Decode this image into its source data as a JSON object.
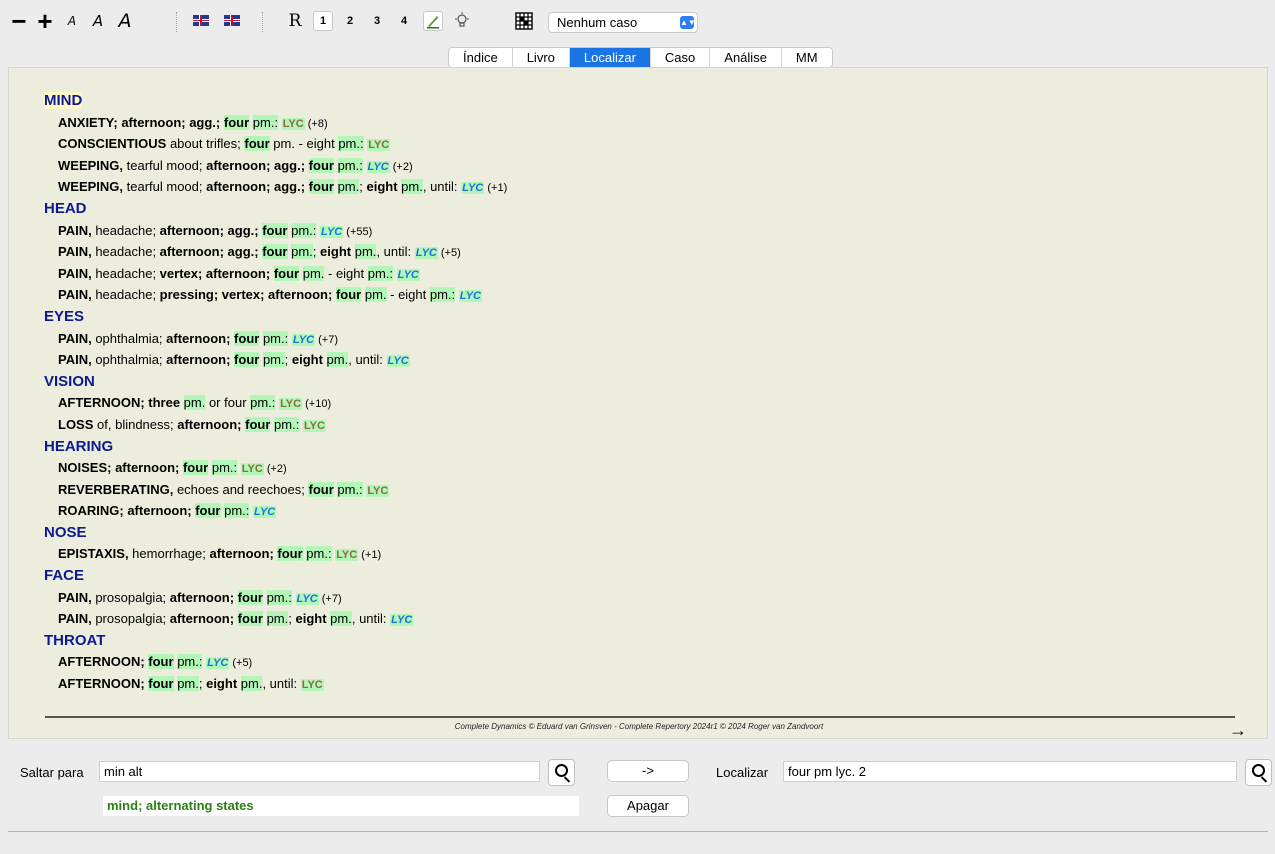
{
  "toolbar": {
    "zoom_out": "−",
    "zoom_in": "+",
    "font_small": "A",
    "font_medium": "A",
    "font_large": "A",
    "btn_r": "R",
    "btn_1": "1",
    "btn_2": "2",
    "btn_3": "3",
    "btn_4": "4",
    "case_select": "Nenhum caso"
  },
  "tabs": [
    "Índice",
    "Livro",
    "Localizar",
    "Caso",
    "Análise",
    "MM"
  ],
  "active_tab": "Localizar",
  "results": [
    {
      "kind": "chapter",
      "text": "MIND"
    },
    {
      "kind": "rubric",
      "parts": [
        [
          "ANXIETY; afternoon; agg.; ",
          "b"
        ],
        [
          "four",
          "bh"
        ],
        [
          " ",
          ""
        ],
        [
          "pm.:",
          "h"
        ],
        [
          " ",
          ""
        ],
        [
          "LYC",
          "g1"
        ],
        [
          " (+8)",
          "c"
        ]
      ]
    },
    {
      "kind": "rubric",
      "parts": [
        [
          "CONSCIENTIOUS",
          "b"
        ],
        [
          " about trifles; ",
          ""
        ],
        [
          "four",
          "bh"
        ],
        [
          " pm. - eight ",
          ""
        ],
        [
          "pm.:",
          "h"
        ],
        [
          " ",
          ""
        ],
        [
          "LYC",
          "g1"
        ]
      ]
    },
    {
      "kind": "rubric",
      "parts": [
        [
          "WEEPING,",
          "b"
        ],
        [
          " tearful mood; ",
          ""
        ],
        [
          "afternoon; agg.; ",
          "b"
        ],
        [
          "four",
          "bh"
        ],
        [
          " ",
          ""
        ],
        [
          "pm.:",
          "h"
        ],
        [
          " ",
          ""
        ],
        [
          "LYC",
          "g3"
        ],
        [
          " (+2)",
          "c"
        ]
      ]
    },
    {
      "kind": "rubric",
      "parts": [
        [
          "WEEPING,",
          "b"
        ],
        [
          " tearful mood; ",
          ""
        ],
        [
          "afternoon; agg.; ",
          "b"
        ],
        [
          "four",
          "bh"
        ],
        [
          " ",
          ""
        ],
        [
          "pm.",
          "h"
        ],
        [
          "; ",
          ""
        ],
        [
          "eight",
          "b"
        ],
        [
          " ",
          ""
        ],
        [
          "pm.",
          "h"
        ],
        [
          ", until: ",
          ""
        ],
        [
          "LYC",
          "g3"
        ],
        [
          " (+1)",
          "c"
        ]
      ]
    },
    {
      "kind": "chapter",
      "text": "HEAD"
    },
    {
      "kind": "rubric",
      "parts": [
        [
          "PAIN,",
          "b"
        ],
        [
          " headache; ",
          ""
        ],
        [
          "afternoon; agg.; ",
          "b"
        ],
        [
          "four",
          "bh"
        ],
        [
          " ",
          ""
        ],
        [
          "pm.:",
          "h"
        ],
        [
          " ",
          ""
        ],
        [
          "LYC",
          "g3"
        ],
        [
          " (+55)",
          "c"
        ]
      ]
    },
    {
      "kind": "rubric",
      "parts": [
        [
          "PAIN,",
          "b"
        ],
        [
          " headache; ",
          ""
        ],
        [
          "afternoon; agg.; ",
          "b"
        ],
        [
          "four",
          "bh"
        ],
        [
          " ",
          ""
        ],
        [
          "pm.",
          "h"
        ],
        [
          "; ",
          ""
        ],
        [
          "eight",
          "b"
        ],
        [
          " ",
          ""
        ],
        [
          "pm.",
          "h"
        ],
        [
          ", until: ",
          ""
        ],
        [
          "LYC",
          "g3"
        ],
        [
          " (+5)",
          "c"
        ]
      ]
    },
    {
      "kind": "rubric",
      "parts": [
        [
          "PAIN,",
          "b"
        ],
        [
          " headache; ",
          ""
        ],
        [
          "vertex; afternoon; ",
          "b"
        ],
        [
          "four",
          "bh"
        ],
        [
          " ",
          ""
        ],
        [
          "pm.",
          "h"
        ],
        [
          " - eight ",
          ""
        ],
        [
          "pm.:",
          "h"
        ],
        [
          " ",
          ""
        ],
        [
          "LYC",
          "g3"
        ]
      ]
    },
    {
      "kind": "rubric",
      "parts": [
        [
          "PAIN,",
          "b"
        ],
        [
          " headache; ",
          ""
        ],
        [
          "pressing; vertex; afternoon; ",
          "b"
        ],
        [
          "four",
          "bh"
        ],
        [
          " ",
          ""
        ],
        [
          "pm.",
          "h"
        ],
        [
          " - eight ",
          ""
        ],
        [
          "pm.:",
          "h"
        ],
        [
          " ",
          ""
        ],
        [
          "LYC",
          "g3"
        ]
      ]
    },
    {
      "kind": "chapter",
      "text": "EYES"
    },
    {
      "kind": "rubric",
      "parts": [
        [
          "PAIN,",
          "b"
        ],
        [
          " ophthalmia; ",
          ""
        ],
        [
          "afternoon; ",
          "b"
        ],
        [
          "four",
          "bh"
        ],
        [
          " ",
          ""
        ],
        [
          "pm.:",
          "h"
        ],
        [
          " ",
          ""
        ],
        [
          "LYC",
          "g3"
        ],
        [
          " (+7)",
          "c"
        ]
      ]
    },
    {
      "kind": "rubric",
      "parts": [
        [
          "PAIN,",
          "b"
        ],
        [
          " ophthalmia; ",
          ""
        ],
        [
          "afternoon; ",
          "b"
        ],
        [
          "four",
          "bh"
        ],
        [
          " ",
          ""
        ],
        [
          "pm.",
          "h"
        ],
        [
          "; ",
          ""
        ],
        [
          "eight",
          "b"
        ],
        [
          " ",
          ""
        ],
        [
          "pm.",
          "h"
        ],
        [
          ", until: ",
          ""
        ],
        [
          "LYC",
          "g3"
        ]
      ]
    },
    {
      "kind": "chapter",
      "text": "VISION"
    },
    {
      "kind": "rubric",
      "parts": [
        [
          "AFTERNOON; three ",
          "b"
        ],
        [
          "pm.",
          "h"
        ],
        [
          " or four ",
          ""
        ],
        [
          "pm.:",
          "h"
        ],
        [
          " ",
          ""
        ],
        [
          "LYC",
          "g1"
        ],
        [
          " (+10)",
          "c"
        ]
      ]
    },
    {
      "kind": "rubric",
      "parts": [
        [
          "LOSS",
          "b"
        ],
        [
          " of, blindness; ",
          ""
        ],
        [
          "afternoon; ",
          "b"
        ],
        [
          "four",
          "bh"
        ],
        [
          " ",
          ""
        ],
        [
          "pm.:",
          "h"
        ],
        [
          " ",
          ""
        ],
        [
          "LYC",
          "g1"
        ]
      ]
    },
    {
      "kind": "chapter",
      "text": "HEARING"
    },
    {
      "kind": "rubric",
      "parts": [
        [
          "NOISES; afternoon; ",
          "b"
        ],
        [
          "four",
          "bh"
        ],
        [
          " ",
          ""
        ],
        [
          "pm.:",
          "h"
        ],
        [
          " ",
          ""
        ],
        [
          "LYC",
          "g1"
        ],
        [
          " (+2)",
          "c"
        ]
      ]
    },
    {
      "kind": "rubric",
      "parts": [
        [
          "REVERBERATING,",
          "b"
        ],
        [
          " echoes and reechoes; ",
          ""
        ],
        [
          "four",
          "bh"
        ],
        [
          " ",
          ""
        ],
        [
          "pm.:",
          "h"
        ],
        [
          " ",
          ""
        ],
        [
          "LYC",
          "g1"
        ]
      ]
    },
    {
      "kind": "rubric",
      "parts": [
        [
          "ROARING; afternoon; ",
          "b"
        ],
        [
          "four",
          "bh"
        ],
        [
          " ",
          ""
        ],
        [
          "pm.:",
          "h"
        ],
        [
          " ",
          ""
        ],
        [
          "LYC",
          "g3"
        ]
      ]
    },
    {
      "kind": "chapter",
      "text": "NOSE"
    },
    {
      "kind": "rubric",
      "parts": [
        [
          "EPISTAXIS,",
          "b"
        ],
        [
          " hemorrhage; ",
          ""
        ],
        [
          "afternoon; ",
          "b"
        ],
        [
          "four",
          "bh"
        ],
        [
          " ",
          ""
        ],
        [
          "pm.:",
          "h"
        ],
        [
          " ",
          ""
        ],
        [
          "LYC",
          "g1"
        ],
        [
          " (+1)",
          "c"
        ]
      ]
    },
    {
      "kind": "chapter",
      "text": "FACE"
    },
    {
      "kind": "rubric",
      "parts": [
        [
          "PAIN,",
          "b"
        ],
        [
          " prosopalgia; ",
          ""
        ],
        [
          "afternoon; ",
          "b"
        ],
        [
          "four",
          "bh"
        ],
        [
          " ",
          ""
        ],
        [
          "pm.:",
          "h"
        ],
        [
          " ",
          ""
        ],
        [
          "LYC",
          "g3"
        ],
        [
          " (+7)",
          "c"
        ]
      ]
    },
    {
      "kind": "rubric",
      "parts": [
        [
          "PAIN,",
          "b"
        ],
        [
          " prosopalgia; ",
          ""
        ],
        [
          "afternoon; ",
          "b"
        ],
        [
          "four",
          "bh"
        ],
        [
          " ",
          ""
        ],
        [
          "pm.",
          "h"
        ],
        [
          "; ",
          ""
        ],
        [
          "eight",
          "b"
        ],
        [
          " ",
          ""
        ],
        [
          "pm.",
          "h"
        ],
        [
          ", until: ",
          ""
        ],
        [
          "LYC",
          "g3"
        ]
      ]
    },
    {
      "kind": "chapter",
      "text": "THROAT"
    },
    {
      "kind": "rubric",
      "parts": [
        [
          "AFTERNOON; ",
          "b"
        ],
        [
          "four",
          "bh"
        ],
        [
          " ",
          ""
        ],
        [
          "pm.:",
          "h"
        ],
        [
          " ",
          ""
        ],
        [
          "LYC",
          "g3"
        ],
        [
          " (+5)",
          "c"
        ]
      ]
    },
    {
      "kind": "rubric",
      "parts": [
        [
          "AFTERNOON; ",
          "b"
        ],
        [
          "four",
          "bh"
        ],
        [
          " ",
          ""
        ],
        [
          "pm.",
          "h"
        ],
        [
          "; ",
          ""
        ],
        [
          "eight",
          "b"
        ],
        [
          " ",
          ""
        ],
        [
          "pm.",
          "h"
        ],
        [
          ", until: ",
          ""
        ],
        [
          "LYC",
          "g1"
        ]
      ]
    }
  ],
  "footer": {
    "copyright": "Complete Dynamics © Eduard van Grinsven  -  Complete Repertory 2024r1 © 2024 Roger van Zandvoort",
    "next_arrow": "→"
  },
  "bottom": {
    "jump_label": "Saltar para",
    "jump_value": "min alt",
    "go_button": "->",
    "find_label": "Localizar",
    "find_value": "four pm lyc. 2",
    "suggestion_bold": "mind",
    "suggestion_rest": "; alternating states",
    "clear_button": "Apagar"
  },
  "colors": {
    "content_bg": "#ededde",
    "chapter": "#0c1a8f",
    "highlight": "#b2f7b8",
    "remedy_grade1": "#8c6b3d",
    "remedy_grade3": "#1a73e0",
    "active_tab": "#1b74e4",
    "suggestion": "#2b7f16"
  }
}
